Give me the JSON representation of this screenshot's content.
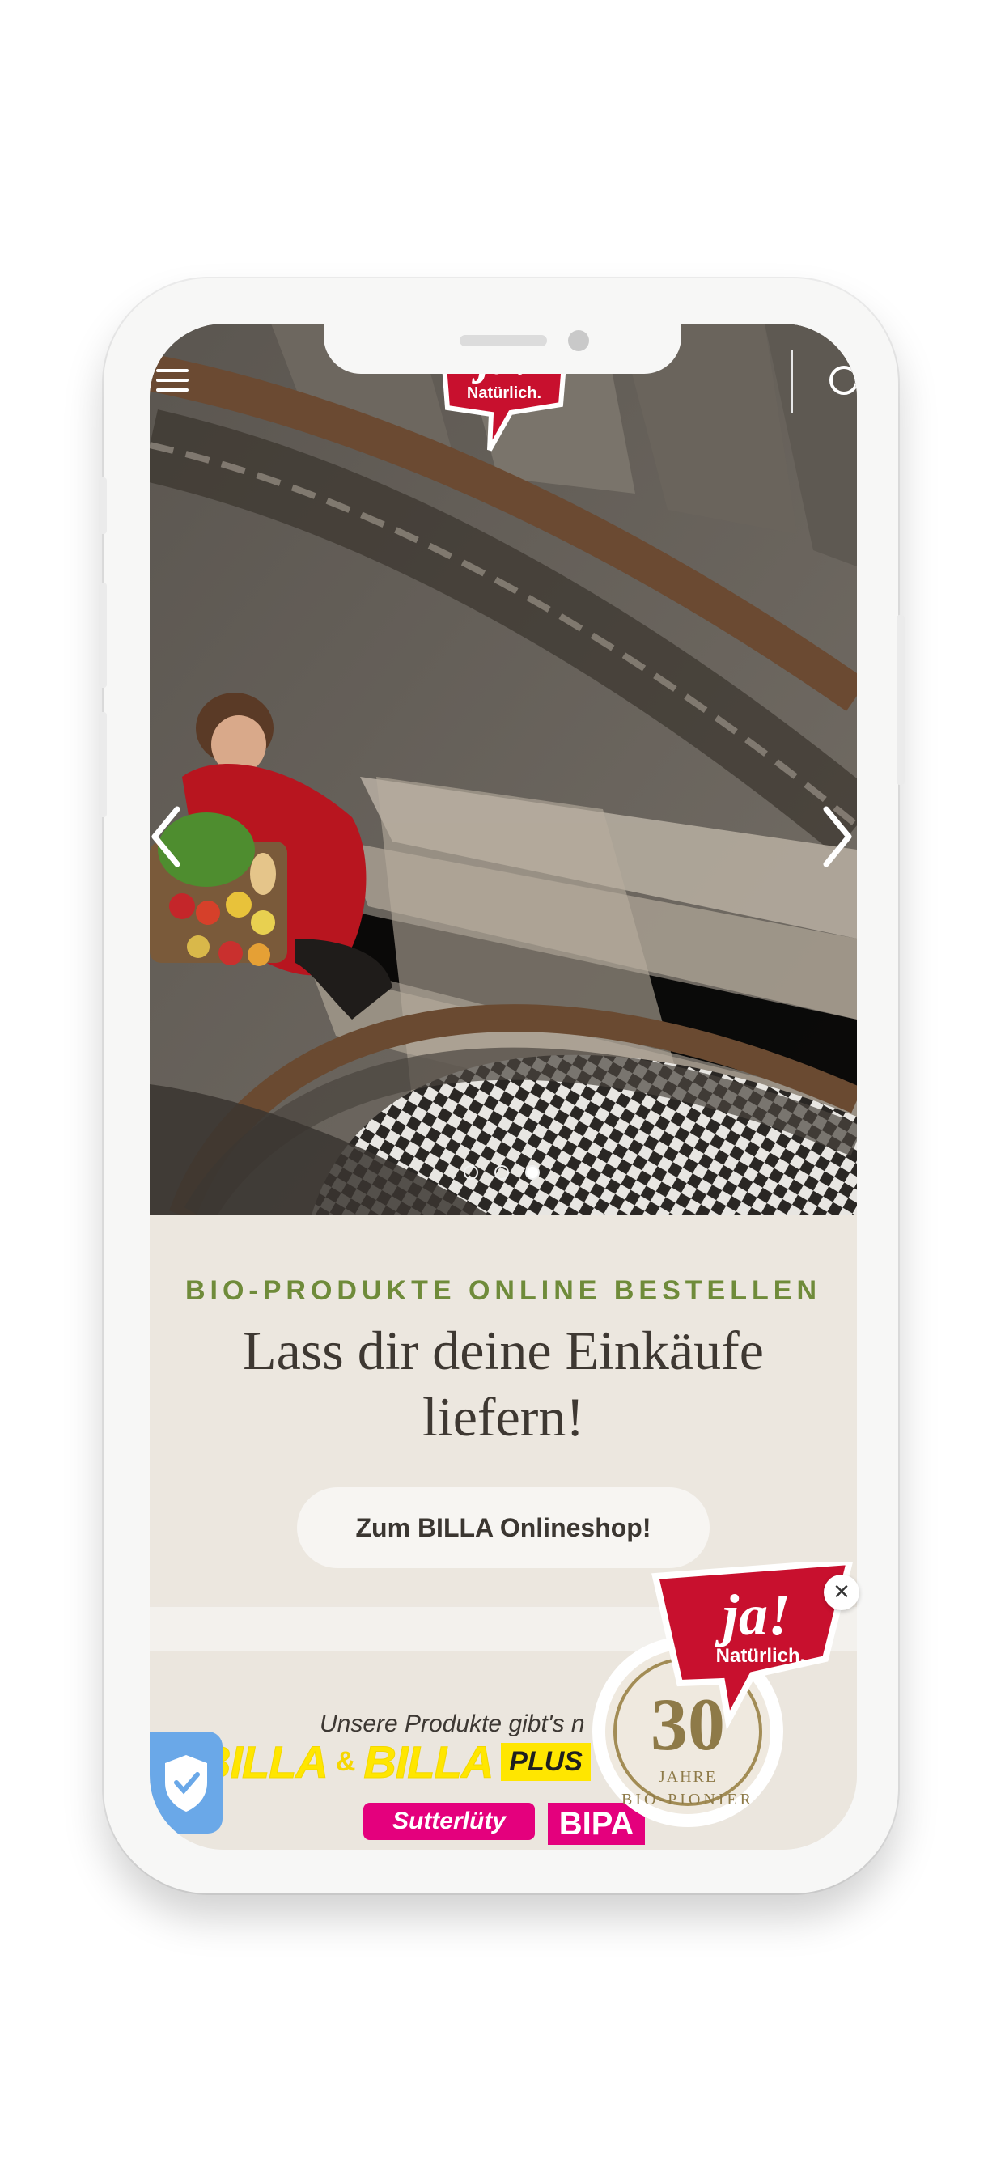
{
  "header": {
    "menu_icon": "hamburger-menu-icon",
    "search_icon": "search-icon",
    "logo": {
      "primary": "ja!",
      "secondary": "Natürlich."
    }
  },
  "carousel": {
    "total_slides": 3,
    "active_slide": 3,
    "prev_icon": "chevron-left-icon",
    "next_icon": "chevron-right-icon"
  },
  "hero_section": {
    "eyebrow": "BIO-PRODUKTE ONLINE BESTELLEN",
    "headline_line1": "Lass dir deine Einkäufe",
    "headline_line2": "liefern!",
    "cta_label": "Zum BILLA Onlineshop!"
  },
  "partners": {
    "title": "Unsere Produkte gibt's n",
    "billa_1": "BILLA",
    "amp": "&",
    "billa_2": "BILLA",
    "plus": "PLUS",
    "sutterluety": "Sutterlüty",
    "bipa": "BIPA"
  },
  "badge": {
    "logo_primary": "ja!",
    "logo_secondary": "Natürlich.",
    "number": "30",
    "years": "JAHRE",
    "pioneer": "BIO-PIONIER",
    "close_label": "×"
  },
  "privacy_button_icon": "shield-check-icon",
  "colors": {
    "accent_green": "#6f8b3a",
    "brand_red": "#c8102e",
    "billa_yellow": "#ffe600",
    "magenta": "#e4007d",
    "shield_blue": "#6aa8e8"
  }
}
